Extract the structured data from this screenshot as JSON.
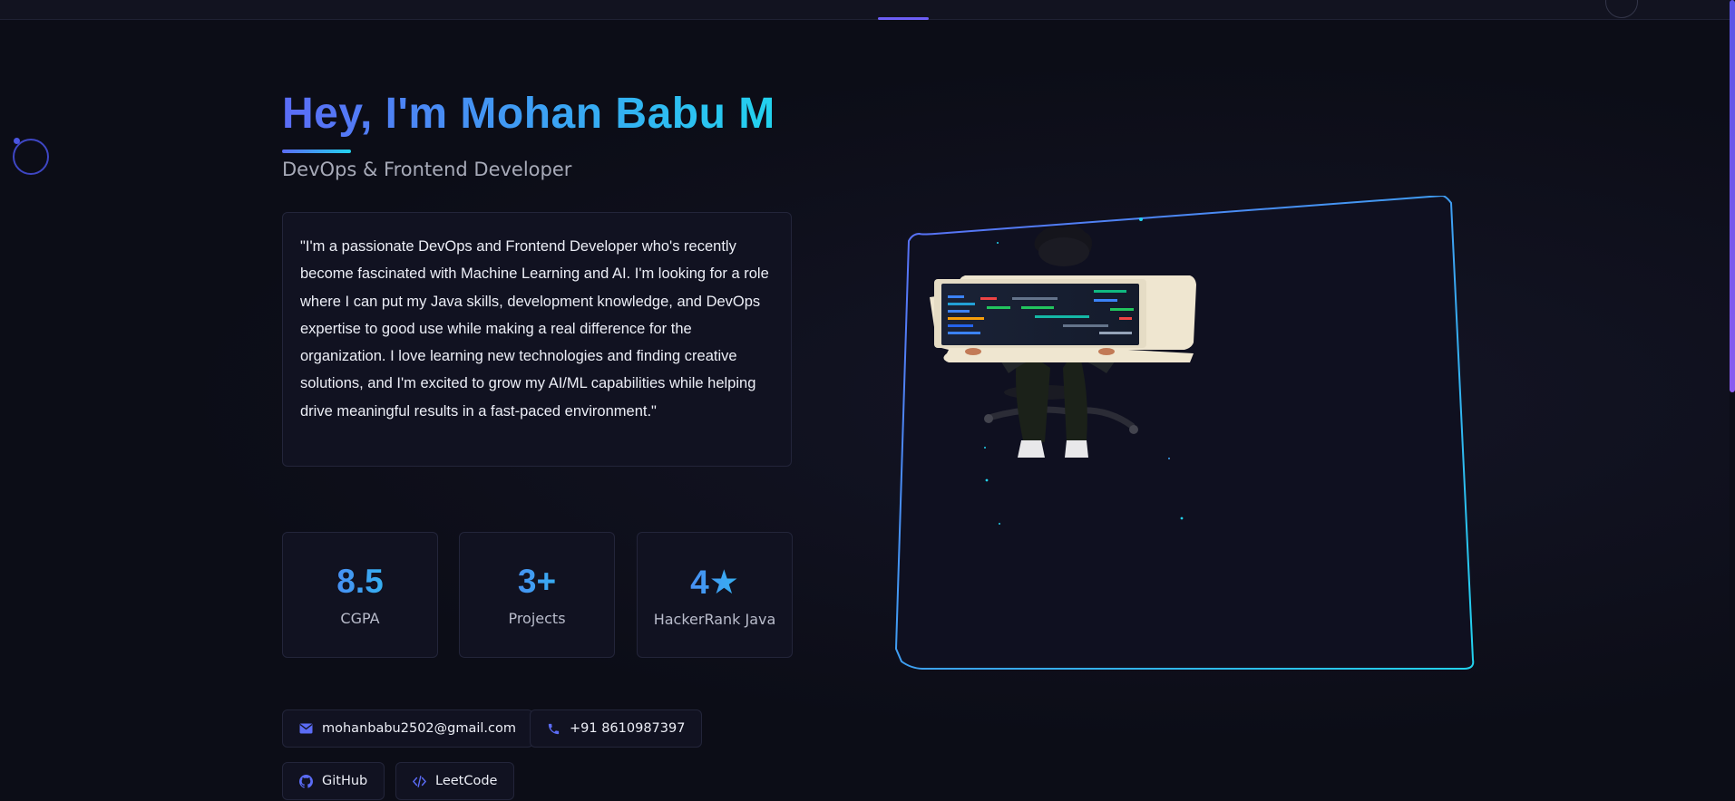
{
  "hero": {
    "title": "Hey, I'm Mohan Babu M",
    "subtitle": "DevOps & Frontend Developer"
  },
  "bio": {
    "text": "\"I'm a passionate DevOps and Frontend Developer who's recently become fascinated with Machine Learning and AI. I'm looking for a role where I can put my Java skills, development knowledge, and DevOps expertise to good use while making a real difference for the organization. I love learning new technologies and finding creative solutions, and I'm excited to grow my AI/ML capabilities while helping drive meaningful results in a fast-paced environment.\""
  },
  "stats": [
    {
      "value": "8.5",
      "label": "CGPA"
    },
    {
      "value": "3+",
      "label": "Projects"
    },
    {
      "value": "4★",
      "label": "HackerRank Java"
    }
  ],
  "contacts": {
    "email": {
      "label": "mohanbabu2502@gmail.com",
      "icon": "envelope-icon"
    },
    "phone": {
      "label": "+91 8610987397",
      "icon": "phone-icon"
    },
    "github": {
      "label": "GitHub",
      "icon": "github-icon"
    },
    "leetcode": {
      "label": "LeetCode",
      "icon": "code-icon"
    }
  },
  "colors": {
    "background": "#0c0d17",
    "accent_start": "#5b6cf6",
    "accent_end": "#22d3ee",
    "card_bg": "#111221",
    "card_border": "#23253a"
  },
  "scroll": {
    "position_fraction": 0.0,
    "visible_fraction": 0.49
  }
}
